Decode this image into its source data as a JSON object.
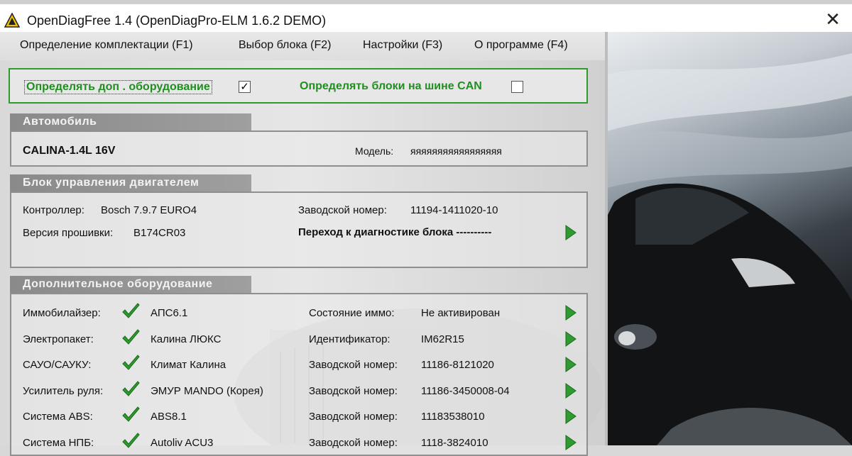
{
  "window": {
    "title": "OpenDiagFree 1.4 (OpenDiagPro-ELM 1.6.2 DEMO)",
    "close_glyph": "✕"
  },
  "menu": [
    "Определение комплектации (F1)",
    "Выбор блока (F2)",
    "Настройки (F3)",
    "О программе (F4)"
  ],
  "options": {
    "detect_extra_label": "Определять доп . оборудование",
    "detect_extra_checked": "✓",
    "detect_can_label": "Определять блоки на шине CAN",
    "detect_can_checked": ""
  },
  "car": {
    "header": "Автомобиль",
    "name": "CALINA-1.4L 16V",
    "model_label": "Модель:",
    "model_value": "яяяяяяяяяяяяяяяяя"
  },
  "ecu": {
    "header": "Блок управления двигателем",
    "controller_label": "Контроллер:",
    "controller_value": "Bosch 7.9.7 EURO4",
    "serial_label": "Заводской номер:",
    "serial_value": "11194-1411020-10",
    "firmware_label": "Версия прошивки:",
    "firmware_value": "B174CR03",
    "goto_label": "Переход к диагностике блока ----------"
  },
  "extra": {
    "header": "Дополнительное оборудование",
    "rows": [
      {
        "label": "Иммобилайзер:",
        "value": "АПС6.1",
        "prop": "Состояние иммо:",
        "prop_value": "Не активирован"
      },
      {
        "label": "Электропакет:",
        "value": "Калина ЛЮКС",
        "prop": "Идентификатор:",
        "prop_value": "IM62R15"
      },
      {
        "label": "САУО/САУКУ:",
        "value": "Климат Калина",
        "prop": "Заводской номер:",
        "prop_value": "11186-8121020"
      },
      {
        "label": "Усилитель руля:",
        "value": "ЭМУР MANDO (Корея)",
        "prop": "Заводской номер:",
        "prop_value": "11186-3450008-04"
      },
      {
        "label": "Система ABS:",
        "value": "ABS8.1",
        "prop": "Заводской номер:",
        "prop_value": "11183538010"
      },
      {
        "label": "Система НПБ:",
        "value": "Autoliv ACU3",
        "prop": "Заводской номер:",
        "prop_value": "1118-3824010"
      }
    ]
  },
  "colors": {
    "accent_green": "#1f8f1f",
    "section_gray": "#8f8f8f"
  },
  "icons": {
    "status": "check-icon",
    "navigate": "green-arrow-icon"
  }
}
